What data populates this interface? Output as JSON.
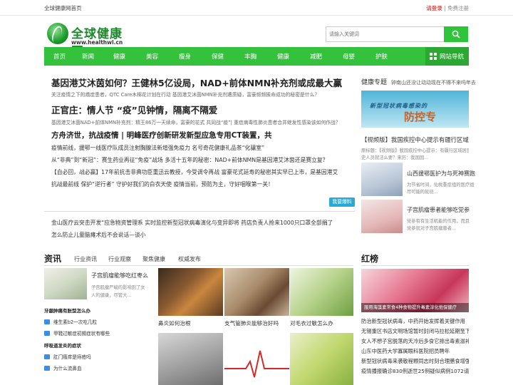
{
  "topbar": {
    "site": "全球健康网首页",
    "login": "请登录",
    "sep": " | ",
    "register": "免费注册"
  },
  "logo": {
    "name": "全球健康网",
    "url": "www.healthwl.cn"
  },
  "search": {
    "placeholder": "请输入关键词"
  },
  "nav": {
    "items": [
      "首页",
      "新闻",
      "健康",
      "美容",
      "瘦身",
      "保健",
      "丰胸",
      "健康",
      "减肥",
      "母婴",
      "护肤"
    ],
    "all": "网站导航"
  },
  "headlines": [
    {
      "title": "基因港艾沐茵如何？王健林5亿设局，NAD+前体NMN补充剂或成最大赢",
      "summary": "关注疫情之下的癌症患者，QTC Care木棉花计划在行动 基因港艾沐茵NMN补充剂遭质疑，富豪频频挨命成功的秘密是什么？"
    },
    {
      "title": "正官庄：情人节 “疫”见钟情，隔离不隔爱",
      "summary": "基因港艾沐茵NAD+前体NMN补充剂：精王86万一天续命，富豪的花式 共同战“疫”| 重症病毒性肺炎患者合并继发性感染该如何作战？"
    },
    {
      "title": "方舟济世，抗战疫情 | 明峰医疗创新研发新型应急专用CT装置，共",
      "summary": ""
    }
  ],
  "news_lines": [
    "疫情前线，援鄂一线医疗队成员注射胸腺法新增强免疫力   名号奇花健康礼品茶“化骧室”",
    "从“非典”到“新冠”：赛生药业再征“免疫”战场    多活十五年的秘密：NAD+前体NMN是基因港艾沐茵还是赛立复？",
    "【自必回，战必赢】17年前抗击非典功臣重迅云教授，今受调令再战   富豪花式延寿的秘密其实早已上市，是基因港艾",
    "抗战最前线 保护“逆行者” 守护好我们的白衣天使    疫情当前，预防为主，守好咽喉第一关！"
  ],
  "more_btn": "我要爆料",
  "bottom_lines": [
    "金山医疗云突击开发“应急物资管理系    实时监控新型冠状病毒演化与变异即将 药店负责人抢来1000只口罩全部捐了",
    "怎么防止儿童脑瘫术后不会说话—谈小"
  ],
  "sidebar": {
    "header": "健康专题",
    "header_sub": "钟南山还没让动动现在不得不来吗年去",
    "banner_t1": "新型冠状病毒感染的",
    "banner_t2": "防控专",
    "video_title": "【视频版】我国疾控中心提示有疆行区域",
    "video_sum1": "原标题：【视频版】我国疾控中心提示：有疆行区域居民",
    "video_sum2": "史人员就法么要？来历：我国国...",
    "items": [
      {
        "title": "山西援鄂医护为与死神赛跑",
        "sum1": "为节省时间，仙桃重症组的医疗组",
        "sum2": "尽可能的轮班..."
      },
      {
        "title": "子宫肌瘤患者能够吃党参",
        "sum1": "党参有有生活机能的作用，而且",
        "sum2": "党参就对子宫肌瘤患者..."
      }
    ]
  },
  "zixun": {
    "title": "资讯",
    "tabs": [
      "行业资讯",
      "行业观察",
      "聚焦健康",
      "权威发布"
    ],
    "feature_title": "子宫肌瘤能够吃红枣么",
    "feature_sum1": "子宫肌瘤严峻的影响到了女",
    "feature_sum2": "人的健康，尽管大...",
    "group1_head": "牙龈肿痛有胀型怎么办",
    "group1": [
      "维生素b2一次吃几粒",
      "甲鞋过敏症初期症状有哪些"
    ],
    "group2_head": "呼吸道发炎的症状",
    "group2": [
      "肛门瘙痒是痔疮吗",
      "为什么流鼻血"
    ],
    "captions": [
      "鼻炎如何治根",
      "支气管肺炎能够治好吗",
      "对毛衣过敏怎么办"
    ]
  },
  "hot": {
    "title": "红榜",
    "banner_caption": "服用海藻素常食4种食物提升毒素淳化他保健疗",
    "lines": [
      "防治新型冠状病毒，中药开始发挥着关键作用",
      "无锡重区书店文明场馆暂时封闭马拉松延期至下",
      "女人不想子宫脱落的天冷后多食它排出毒素滋补",
      "山东中医药大学寡属眼科医院招员聘年",
      "新型冠状病毒来袭敬程颗同志时刻合理膳食增强抵",
      "疫情播报确诊830例逝世25例疑似病例1072请假"
    ]
  }
}
